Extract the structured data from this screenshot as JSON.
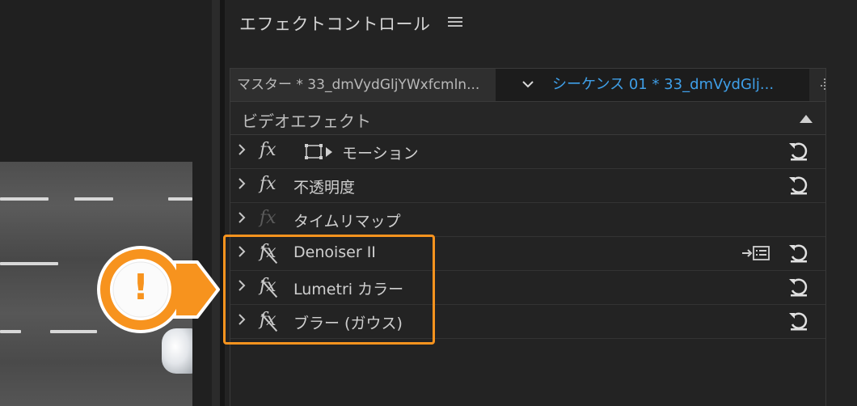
{
  "panel": {
    "title": "エフェクトコントロール"
  },
  "clips": {
    "master": "マスター * 33_dmVydGljYWxfcmln...",
    "sequence": "シーケンス 01 * 33_dmVydGlj..."
  },
  "section": {
    "title": "ビデオエフェクト"
  },
  "effects": [
    {
      "name": "モーション",
      "icon": "fx-icon",
      "has_transform_icon": true,
      "reset": true
    },
    {
      "name": "不透明度",
      "icon": "fx-icon",
      "reset": true
    },
    {
      "name": "タイムリマップ",
      "icon": "fx-icon-dim",
      "reset": false
    },
    {
      "name": "Denoiser II",
      "icon": "fx-disabled-icon",
      "reset": true,
      "keyframe_list": true
    },
    {
      "name": "Lumetri カラー",
      "icon": "fx-disabled-icon",
      "reset": true
    },
    {
      "name": "ブラー (ガウス)",
      "icon": "fx-disabled-icon",
      "reset": true
    }
  ],
  "callout": {
    "symbol": "!",
    "color": "#f7931e"
  },
  "colors": {
    "accent_blue": "#3f9fe8",
    "highlight_orange": "#f7931e"
  }
}
